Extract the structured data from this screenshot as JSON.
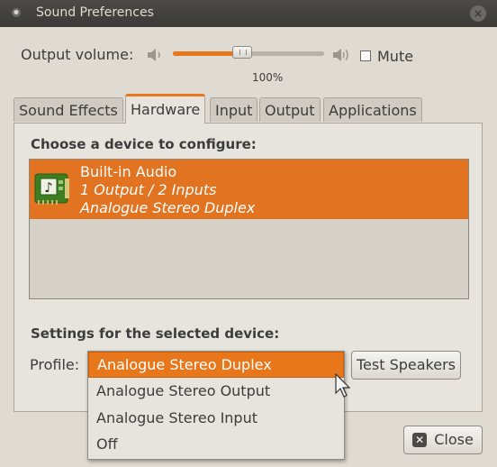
{
  "window": {
    "title": "Sound Preferences"
  },
  "volume": {
    "label": "Output volume:",
    "percent_text": "100%",
    "level": 0.46,
    "mute_label": "Mute",
    "mute_checked": false
  },
  "tabs": [
    {
      "label": "Sound Effects",
      "active": false
    },
    {
      "label": "Hardware",
      "active": true
    },
    {
      "label": "Input",
      "active": false
    },
    {
      "label": "Output",
      "active": false
    },
    {
      "label": "Applications",
      "active": false
    }
  ],
  "hardware": {
    "choose_heading": "Choose a device to configure:",
    "devices": [
      {
        "name": "Built-in Audio",
        "detail": "1 Output / 2 Inputs",
        "profile": "Analogue Stereo Duplex",
        "icon": "sound-card-icon",
        "selected": true
      }
    ],
    "settings_heading": "Settings for the selected device:",
    "profile_label": "Profile:",
    "profile_options": [
      "Analogue Stereo Duplex",
      "Analogue Stereo Output",
      "Analogue Stereo Input",
      "Off"
    ],
    "profile_selected": "Analogue Stereo Duplex",
    "test_button": "Test Speakers"
  },
  "footer": {
    "close_button": "Close"
  },
  "colors": {
    "accent": "#e8761b",
    "titlebar": "#3c3b37",
    "window_bg": "#dfdbd2"
  }
}
